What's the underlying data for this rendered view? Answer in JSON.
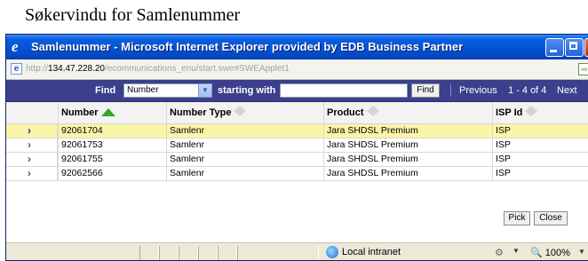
{
  "doc_title": "Søkervindu for Samlenummer",
  "window": {
    "title": "Samlenummer - Microsoft Internet Explorer provided by EDB Business Partner",
    "url_prefix": "http://",
    "url_host": "134.47.228.20",
    "url_path": "/ecommunications_enu/start.swe#SWEApplet1"
  },
  "findbar": {
    "find_label": "Find",
    "field_selected": "Number",
    "starting_label": "starting with",
    "input_value": "",
    "find_button": "Find",
    "previous_label": "Previous",
    "range_label": "1 - 4 of 4",
    "next_label": "Next"
  },
  "table": {
    "columns": [
      "Number",
      "Number Type",
      "Product",
      "ISP Id"
    ],
    "rows": [
      {
        "number": "92061704",
        "type": "Samlenr",
        "product": "Jara SHDSL Premium",
        "isp": "ISP"
      },
      {
        "number": "92061753",
        "type": "Samlenr",
        "product": "Jara SHDSL Premium",
        "isp": "ISP"
      },
      {
        "number": "92061755",
        "type": "Samlenr",
        "product": "Jara SHDSL Premium",
        "isp": "ISP"
      },
      {
        "number": "92062566",
        "type": "Samlenr",
        "product": "Jara SHDSL Premium",
        "isp": "ISP"
      }
    ]
  },
  "buttons": {
    "pick": "Pick",
    "close": "Close"
  },
  "statusbar": {
    "zone": "Local intranet",
    "zoom": "100%"
  },
  "colors": {
    "titlebar": "#0455d6",
    "findbar": "#3b3f8c",
    "selected_row": "#fbf5a8"
  }
}
